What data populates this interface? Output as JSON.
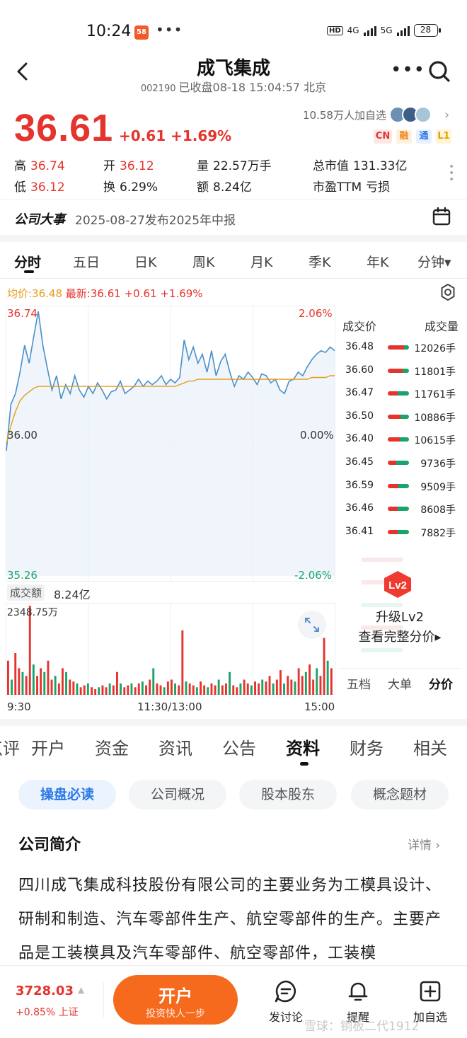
{
  "status_bar": {
    "time": "10:24",
    "app_badge": "58",
    "dots": "•••",
    "hd": "HD",
    "net1": "4G",
    "net2": "5G",
    "battery": "28"
  },
  "header": {
    "title": "成飞集成",
    "code": "002190",
    "status": "已收盘08-18 15:04:57 北京"
  },
  "quote": {
    "price": "36.61",
    "change": "+0.61 +1.69%",
    "follow_count": "10.58万人加自选",
    "badges": [
      "CN",
      "融",
      "通",
      "L1"
    ],
    "stats": [
      {
        "label": "高",
        "value": "36.74",
        "color": "red"
      },
      {
        "label": "开",
        "value": "36.12",
        "color": "red"
      },
      {
        "label": "量",
        "value": "22.57万手",
        "color": "plain"
      },
      {
        "label": "总市值",
        "value": "131.33亿",
        "color": "plain"
      },
      {
        "label": "低",
        "value": "36.12",
        "color": "red"
      },
      {
        "label": "换",
        "value": "6.29%",
        "color": "plain"
      },
      {
        "label": "额",
        "value": "8.24亿",
        "color": "plain"
      },
      {
        "label": "市盈TTM",
        "value": "亏损",
        "color": "plain"
      }
    ]
  },
  "events": {
    "title": "公司大事",
    "text": "2025-08-27发布2025年中报"
  },
  "chart_tabs": [
    "分时",
    "五日",
    "日K",
    "周K",
    "月K",
    "季K",
    "年K",
    "分钟▾"
  ],
  "chart_legend": {
    "avg": "均价:36.48",
    "latest": "最新:36.61",
    "change": "+0.61",
    "pct": "+1.69%"
  },
  "chart_data": {
    "type": "line",
    "title": "",
    "x_ticks": [
      "9:30",
      "11:30/13:00",
      "15:00"
    ],
    "y_left_ticks": [
      "36.74",
      "36.00",
      "35.26"
    ],
    "y_right_ticks": [
      "2.06%",
      "0.00%",
      "-2.06%"
    ],
    "ylim": [
      35.26,
      36.74
    ],
    "series": [
      {
        "name": "最新",
        "color": "#4a90c8",
        "values": [
          35.96,
          36.22,
          36.28,
          36.4,
          36.55,
          36.45,
          36.6,
          36.74,
          36.55,
          36.42,
          36.3,
          36.38,
          36.25,
          36.33,
          36.28,
          36.38,
          36.3,
          36.26,
          36.32,
          36.28,
          36.34,
          36.3,
          36.25,
          36.29,
          36.3,
          36.35,
          36.28,
          36.3,
          36.32,
          36.36,
          36.32,
          36.35,
          36.33,
          36.35,
          36.38,
          36.33,
          36.36,
          36.34,
          36.37,
          36.58,
          36.47,
          36.54,
          36.45,
          36.5,
          36.4,
          36.52,
          36.38,
          36.46,
          36.5,
          36.4,
          36.32,
          36.38,
          36.36,
          36.4,
          36.37,
          36.33,
          36.39,
          36.38,
          36.34,
          36.36,
          36.3,
          36.28,
          36.35,
          36.36,
          36.4,
          36.38,
          36.43,
          36.47,
          36.5,
          36.52,
          36.51,
          36.54,
          36.52
        ]
      },
      {
        "name": "均价",
        "color": "#e89c1a",
        "values": [
          36.0,
          36.1,
          36.18,
          36.24,
          36.27,
          36.29,
          36.31,
          36.32,
          36.32,
          36.32,
          36.32,
          36.32,
          36.32,
          36.32,
          36.32,
          36.32,
          36.32,
          36.32,
          36.32,
          36.32,
          36.32,
          36.32,
          36.32,
          36.32,
          36.32,
          36.32,
          36.32,
          36.32,
          36.32,
          36.32,
          36.32,
          36.32,
          36.32,
          36.32,
          36.32,
          36.32,
          36.32,
          36.32,
          36.33,
          36.34,
          36.35,
          36.35,
          36.36,
          36.36,
          36.36,
          36.36,
          36.36,
          36.36,
          36.36,
          36.36,
          36.36,
          36.36,
          36.36,
          36.36,
          36.36,
          36.36,
          36.36,
          36.36,
          36.36,
          36.36,
          36.36,
          36.36,
          36.36,
          36.36,
          36.36,
          36.36,
          36.36,
          36.37,
          36.37,
          36.37,
          36.37,
          36.38,
          36.38
        ]
      }
    ],
    "volume": {
      "label": "成交额",
      "total": "8.24亿",
      "max_label": "2348.75万",
      "max": 2348.75,
      "values": [
        900,
        400,
        1100,
        700,
        600,
        500,
        2348,
        800,
        500,
        700,
        600,
        900,
        400,
        500,
        300,
        700,
        600,
        400,
        350,
        300,
        200,
        250,
        300,
        200,
        150,
        200,
        250,
        200,
        300,
        250,
        600,
        300,
        200,
        250,
        300,
        200,
        300,
        350,
        250,
        400,
        700,
        300,
        250,
        200,
        350,
        400,
        300,
        250,
        1700,
        350,
        300,
        250,
        200,
        350,
        250,
        200,
        300,
        250,
        400,
        250,
        300,
        600,
        250,
        200,
        300,
        400,
        300,
        250,
        350,
        300,
        400,
        350,
        500,
        300,
        400,
        650,
        300,
        500,
        400,
        350,
        700,
        500,
        600,
        800,
        400,
        700,
        500,
        1500,
        900,
        700
      ]
    }
  },
  "orderbook": {
    "head_price": "成交价",
    "head_qty": "成交量",
    "rows": [
      {
        "price": "36.48",
        "qty": "12026手",
        "red": 0.75
      },
      {
        "price": "36.60",
        "qty": "11801手",
        "red": 0.7
      },
      {
        "price": "36.47",
        "qty": "11761手",
        "red": 0.45
      },
      {
        "price": "36.50",
        "qty": "10886手",
        "red": 0.6
      },
      {
        "price": "36.40",
        "qty": "10615手",
        "red": 0.55
      },
      {
        "price": "36.45",
        "qty": "9736手",
        "red": 0.4
      },
      {
        "price": "36.59",
        "qty": "9509手",
        "red": 0.5
      },
      {
        "price": "36.46",
        "qty": "8608手",
        "red": 0.45
      },
      {
        "price": "36.41",
        "qty": "7882手",
        "red": 0.45
      }
    ],
    "lv2_badge": "Lv2",
    "lv2_title": "升级Lv2",
    "lv2_sub": "查看完整分价▸",
    "tabs": [
      "五档",
      "大单",
      "分价"
    ]
  },
  "info_tabs": [
    "点评",
    "开户",
    "资金",
    "资讯",
    "公告",
    "资料",
    "财务",
    "相关"
  ],
  "chips": [
    "操盘必读",
    "公司概况",
    "股本股东",
    "概念题材"
  ],
  "intro": {
    "title": "公司简介",
    "more": "详情 ›",
    "body": "四川成飞集成科技股份有限公司的主要业务为工模具设计、研制和制造、汽车零部件生产、航空零部件的生产。主要产品是工装模具及汽车零部件、航空零部件，工装模"
  },
  "bottom": {
    "index_value": "3728.03",
    "index_arrow": "▲",
    "index_change": "+0.85% 上证",
    "open_title": "开户",
    "open_sub": "投资快人一步",
    "items": [
      "发讨论",
      "提醒",
      "加自选"
    ],
    "watermark": "雪球：铜板二代1912"
  }
}
